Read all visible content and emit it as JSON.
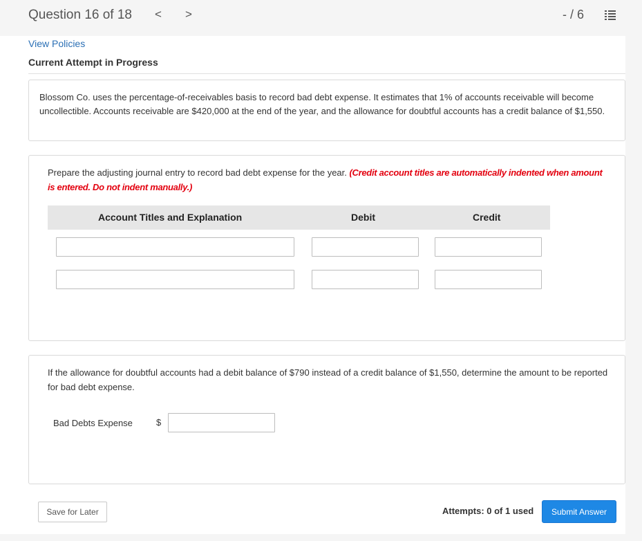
{
  "header": {
    "question_label": "Question 16 of 18",
    "prev_glyph": "<",
    "next_glyph": ">",
    "score": "- / 6"
  },
  "links": {
    "view_policies": "View Policies"
  },
  "status": {
    "attempt_heading": "Current Attempt in Progress"
  },
  "problem": {
    "text": "Blossom Co. uses the percentage-of-receivables basis to record bad debt expense. It estimates that 1% of accounts receivable will become uncollectible. Accounts receivable are $420,000 at the end of the year, and the allowance for doubtful accounts has a credit balance of $1,550."
  },
  "part1": {
    "instruction": "Prepare the adjusting journal entry to record bad debt expense for the year. ",
    "instruction_note": "(Credit account titles are automatically indented when amount is entered. Do not indent manually.)",
    "columns": {
      "account": "Account Titles and Explanation",
      "debit": "Debit",
      "credit": "Credit"
    },
    "rows": [
      {
        "account": "",
        "debit": "",
        "credit": ""
      },
      {
        "account": "",
        "debit": "",
        "credit": ""
      }
    ]
  },
  "part2": {
    "question": "If the allowance for doubtful accounts had a debit balance of $790 instead of a credit balance of $1,550, determine the amount to be reported for bad debt expense.",
    "label": "Bad Debts Expense",
    "currency": "$",
    "value": ""
  },
  "footer": {
    "save_label": "Save for Later",
    "attempts": "Attempts: 0 of 1 used",
    "submit_label": "Submit Answer"
  },
  "colors": {
    "link": "#2a6fb5",
    "note_red": "#e3000f",
    "submit_bg": "#1e88e5"
  },
  "icons": {
    "list": "question-list-icon"
  }
}
